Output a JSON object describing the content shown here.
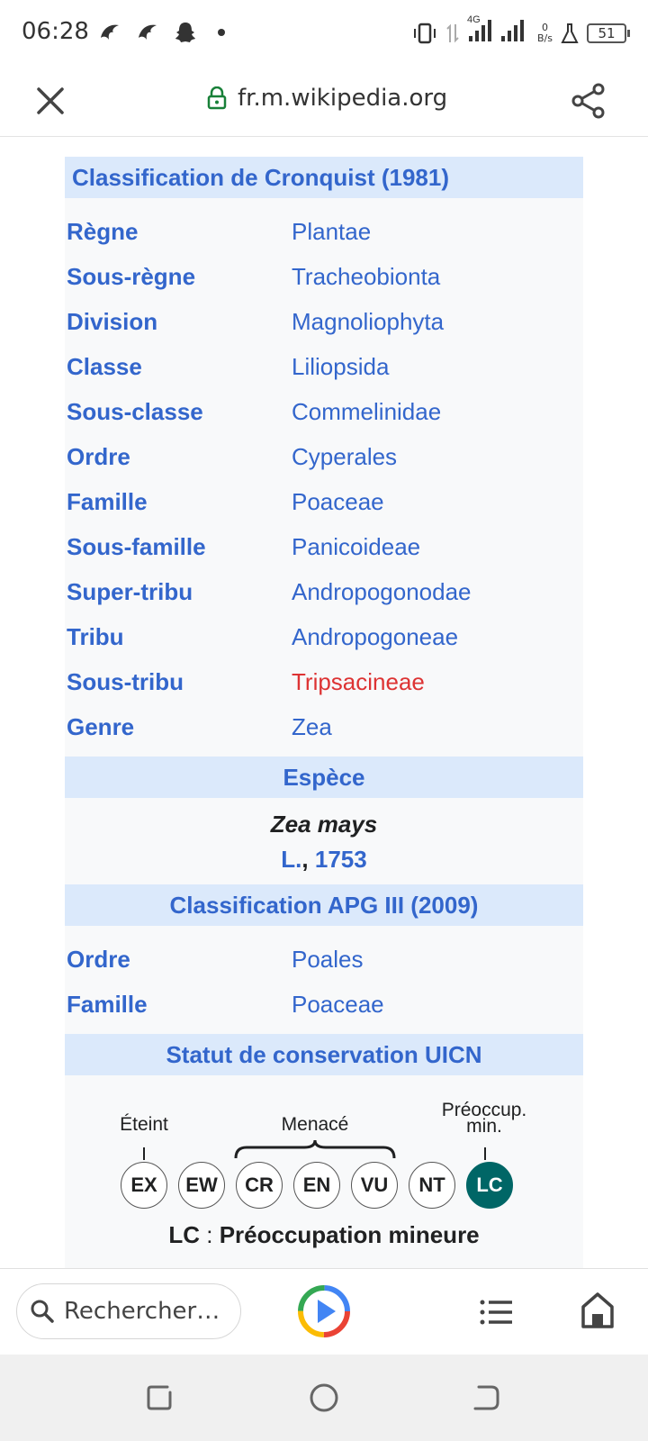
{
  "status_bar": {
    "time": "06:28",
    "network": "4G",
    "speed_value": "0",
    "speed_unit": "B/s",
    "battery": "51"
  },
  "url_bar": {
    "url": "fr.m.wikipedia.org"
  },
  "taxobox": {
    "cronquist_header": "Classification de Cronquist (1981)",
    "cronquist_rows": [
      {
        "label": "Règne",
        "value": "Plantae"
      },
      {
        "label": "Sous-règne",
        "value": "Tracheobionta"
      },
      {
        "label": "Division",
        "value": "Magnoliophyta"
      },
      {
        "label": "Classe",
        "value": "Liliopsida"
      },
      {
        "label": "Sous-classe",
        "value": "Commelinidae"
      },
      {
        "label": "Ordre",
        "value": "Cyperales"
      },
      {
        "label": "Famille",
        "value": "Poaceae"
      },
      {
        "label": "Sous-famille",
        "value": "Panicoideae"
      },
      {
        "label": "Super-tribu",
        "value": "Andropogonodae"
      },
      {
        "label": "Tribu",
        "value": "Andropogoneae"
      },
      {
        "label": "Sous-tribu",
        "value": "Tripsacineae"
      },
      {
        "label": "Genre",
        "value": "Zea"
      }
    ],
    "species_header": "Espèce",
    "species_name": "Zea mays",
    "species_author": "L.",
    "species_comma": ",",
    "species_year": "1753",
    "apg_header": "Classification APG III (2009)",
    "apg_rows": [
      {
        "label": "Ordre",
        "value": "Poales"
      },
      {
        "label": "Famille",
        "value": "Poaceae"
      }
    ],
    "uicn_header": "Statut de conservation UICN",
    "uicn_label_extinct": "Éteint",
    "uicn_label_threatened": "Menacé",
    "uicn_label_lc_line1": "Préoccup.",
    "uicn_label_lc_line2": "min.",
    "uicn_categories": [
      "EX",
      "EW",
      "CR",
      "EN",
      "VU",
      "NT",
      "LC"
    ],
    "uicn_active": "LC",
    "uicn_status_code": "LC",
    "uicn_status_sep": " : ",
    "uicn_status_text": "Préoccupation mineure",
    "colors": {
      "link": "#3366cc",
      "redlink": "#dd3333",
      "header_bg": "#dbe9fb",
      "lc": "#006666"
    }
  },
  "toolbar": {
    "search_placeholder": "Rechercher…"
  }
}
